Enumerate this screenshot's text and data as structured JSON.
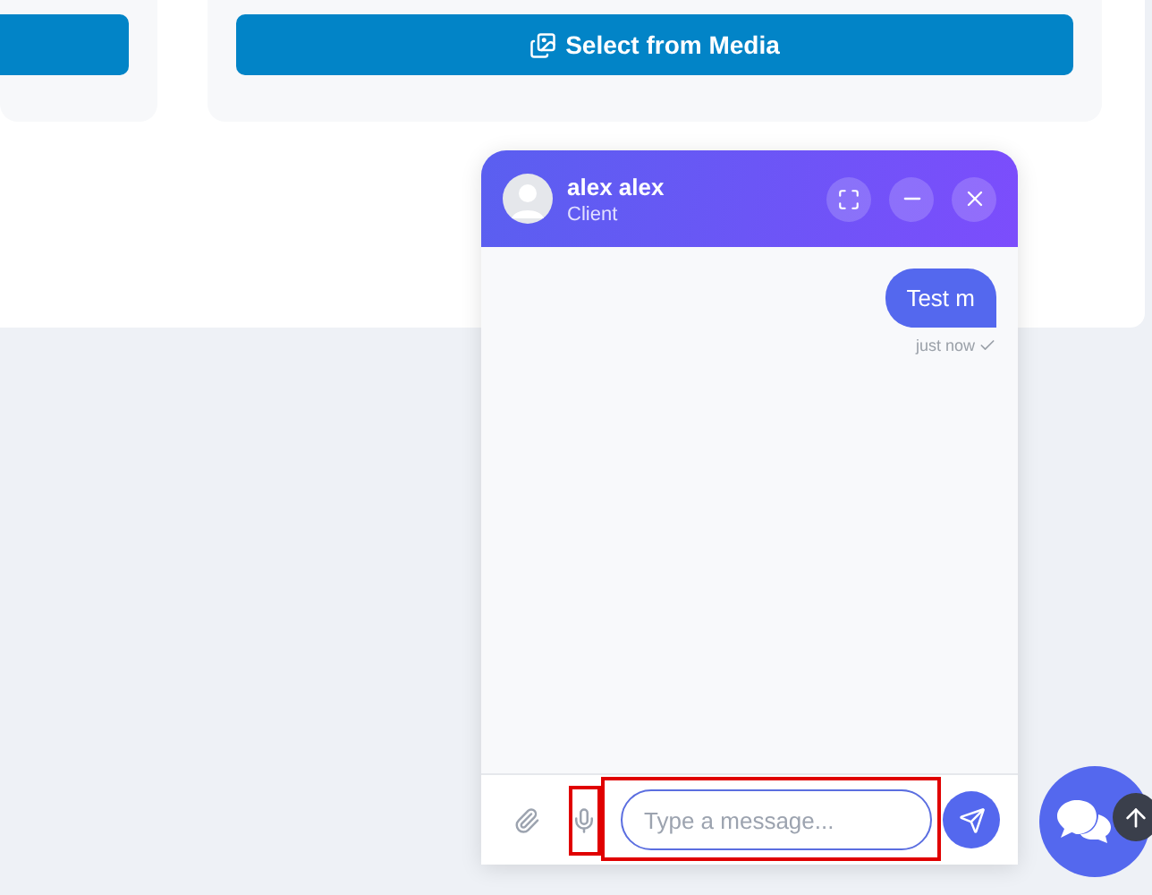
{
  "top_panel": {
    "media_button": {
      "label": "Select from Media"
    }
  },
  "chat": {
    "contact": {
      "name": "alex alex",
      "role": "Client"
    },
    "header_controls": [
      {
        "kind": "expand"
      },
      {
        "kind": "minimize"
      },
      {
        "kind": "close"
      }
    ],
    "messages": [
      {
        "text": "Test m",
        "time": "just now",
        "read": true
      }
    ],
    "composer": {
      "placeholder": "Type a message...",
      "highlighted_mic": true,
      "highlighted_input": true
    }
  }
}
